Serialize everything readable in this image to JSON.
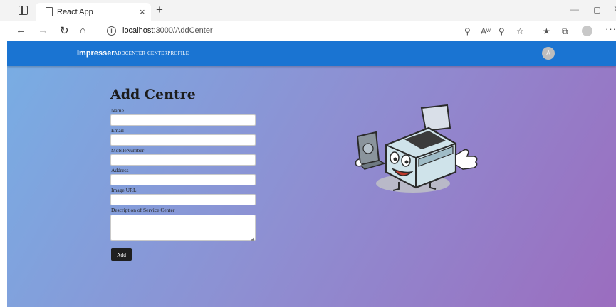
{
  "browser": {
    "tab_title": "React App",
    "tab_close": "×",
    "new_tab": "+",
    "url_host": "localhost",
    "url_path": ":3000/AddCenter",
    "icons": [
      "sidebar-icon",
      "page-icon",
      "back-icon",
      "forward-icon",
      "refresh-icon",
      "home-icon",
      "info-icon",
      "key-icon",
      "read-aloud-icon",
      "zoom-icon",
      "add-favorite-icon",
      "favorites-icon",
      "collections-icon",
      "profile-icon",
      "more-icon"
    ]
  },
  "navbar": {
    "brand": "Impresser",
    "links": [
      "ADDCENTER",
      "CENTERPROFILE"
    ],
    "avatar_letter": "A",
    "color": "#1a74d2"
  },
  "form": {
    "title": "Add Centre",
    "fields": [
      {
        "label": "Name",
        "value": ""
      },
      {
        "label": "Email",
        "value": ""
      },
      {
        "label": "MobileNumber",
        "value": ""
      },
      {
        "label": "Address",
        "value": ""
      },
      {
        "label": "Image URL",
        "value": ""
      },
      {
        "label": "Description of Service Center",
        "value": ""
      }
    ],
    "submit_label": "Add"
  },
  "colors": {
    "gradient_start": "#78aee4",
    "gradient_end": "#9b6dbf",
    "button": "#1f1f1f"
  }
}
